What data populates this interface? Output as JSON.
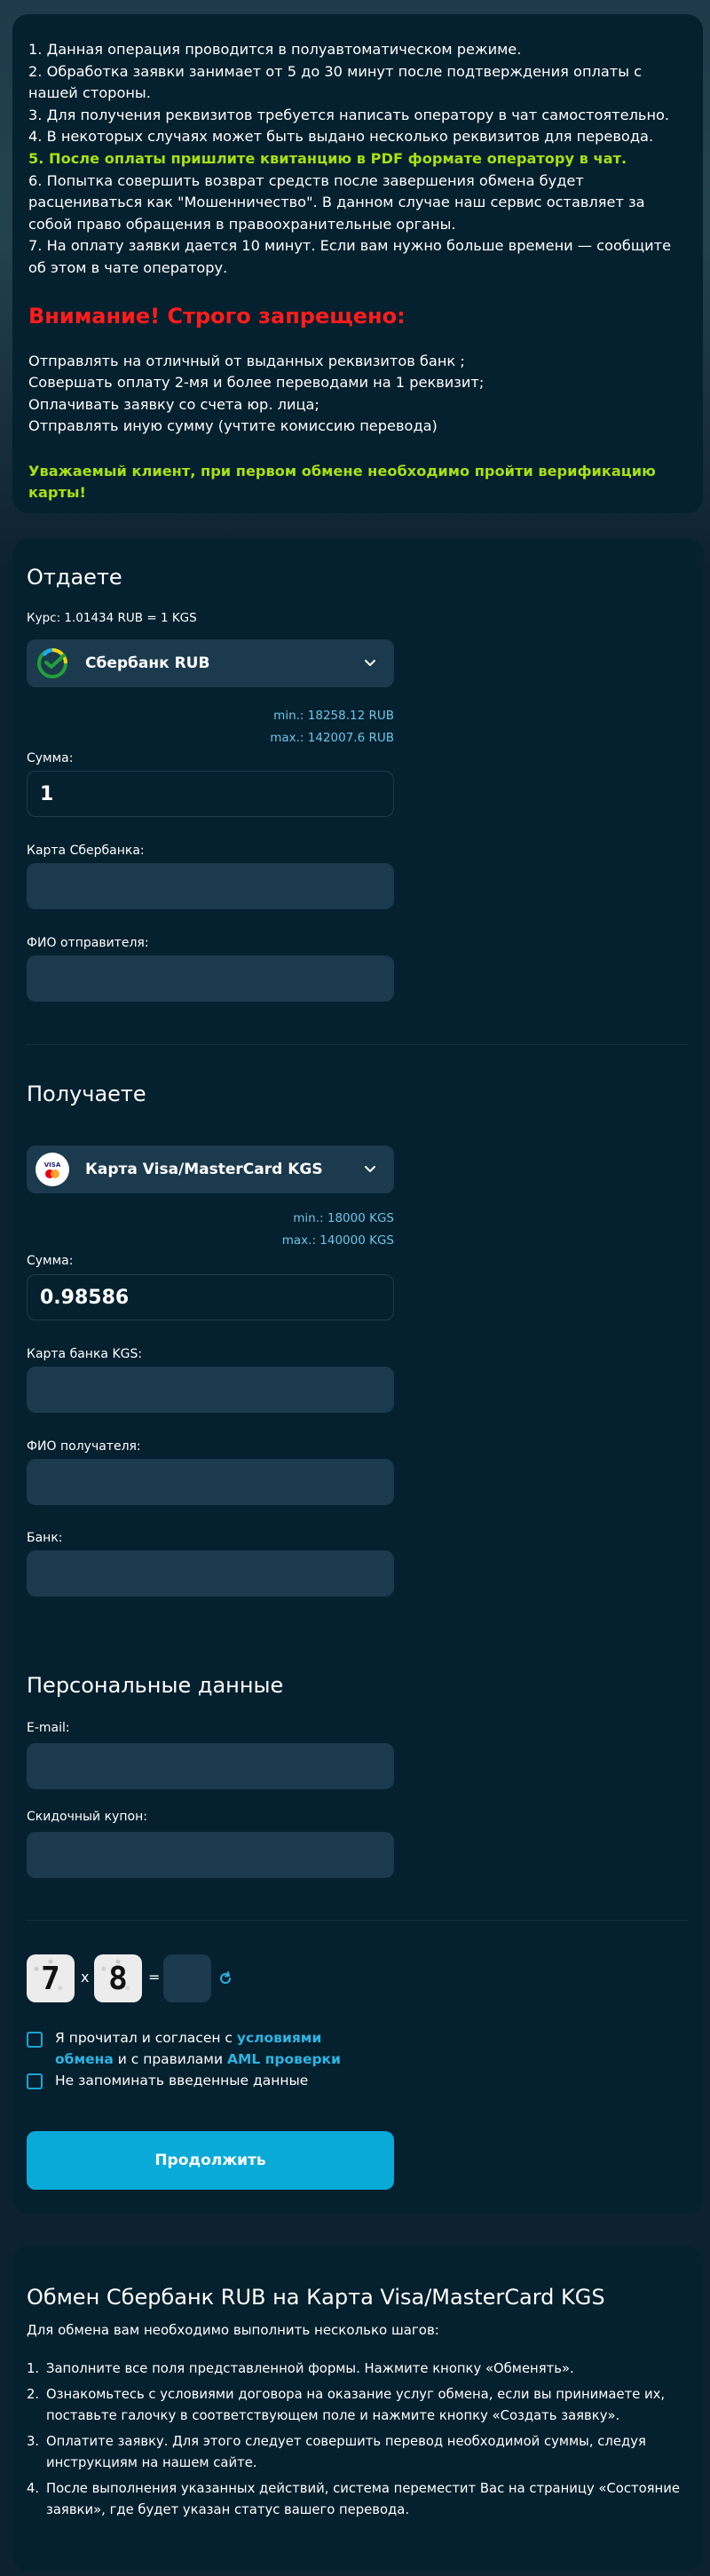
{
  "notice": {
    "rules": [
      "1. Данная операция проводится в полуавтоматическом режиме.",
      "2. Обработка заявки занимает от 5 до 30 минут после подтверждения оплаты с нашей стороны.",
      "3. Для получения реквизитов требуется написать оператору в чат самостоятельно.",
      "4. В некоторых случаях может быть выдано несколько реквизитов для перевода.",
      "5. После оплаты пришлите квитанцию в PDF формате оператору в чат.",
      "6. Попытка совершить возврат средств после завершения обмена будет расцениваться как \"Мошенничество\". В данном случае наш сервис оставляет за собой право обращения в правоохранительные органы.",
      "7. На оплату заявки дается 10 минут. Если вам нужно больше времени — сообщите об этом в чате оператору."
    ],
    "warning_title": "Внимание! Строго запрещено:",
    "forbidden": [
      "Отправлять на отличный от выданных реквизитов банк ;",
      "Совершать оплату 2-мя и более переводами на 1 реквизит;",
      "Оплачивать заявку со счета юр. лица;",
      "Отправлять иную сумму (учтите комиссию перевода)"
    ],
    "verification": "Уважаемый клиент, при первом обмене необходимо пройти верификацию карты!",
    "accent_green": "#a8e014",
    "accent_red": "#ff1c1c"
  },
  "give": {
    "title": "Отдаете",
    "rate": "Курс: 1.01434 RUB = 1 KGS",
    "currency": "Сбербанк RUB",
    "currency_icon": "sberbank-logo-icon",
    "min": "min.: 18258.12 RUB",
    "max": "max.: 142007.6 RUB",
    "amount_label": "Сумма:",
    "amount_value": "1",
    "card_label": "Карта Сбербанка:",
    "name_label": "ФИО отправителя:"
  },
  "get": {
    "title": "Получаете",
    "currency": "Карта Visa/MasterCard KGS",
    "currency_icon": "visa-mastercard-logo-icon",
    "min": "min.: 18000 KGS",
    "max": "max.: 140000 KGS",
    "amount_label": "Сумма:",
    "amount_value": "0.98586",
    "card_label": "Карта банка KGS:",
    "name_label": "ФИО получателя:",
    "bank_label": "Банк:"
  },
  "personal": {
    "title": "Персональные данные",
    "email_label": "E-mail:",
    "coupon_label": "Скидочный купон:"
  },
  "captcha": {
    "a": "7",
    "op": "x",
    "b": "8",
    "eq": "="
  },
  "agreement": {
    "prefix": "Я прочитал и согласен с ",
    "terms_link_1": "условиями",
    "terms_link_2": "обмена",
    "middle": " и с правилами ",
    "aml_link": "AML проверки",
    "remember": "Не запоминать введенные данные"
  },
  "submit_label": "Продолжить",
  "info": {
    "title": "Обмен Сбербанк RUB на Карта Visa/MasterCard KGS",
    "intro": "Для обмена вам необходимо выполнить несколько шагов:",
    "steps": [
      "Заполните все поля представленной формы. Нажмите кнопку «Обменять».",
      "Ознакомьтесь с условиями договора на оказание услуг обмена, если вы принимаете их, поставьте галочку в соответствующем поле и нажмите кнопку «Создать заявку».",
      "Оплатите заявку. Для этого следует совершить перевод необходимой суммы, следуя инструкциям на нашем сайте.",
      "После выполнения указанных действий, система переместит Вас на страницу «Состояние заявки», где будет указан статус вашего перевода."
    ],
    "step_numbers": [
      "1.",
      "2.",
      "3.",
      "4."
    ]
  },
  "colors": {
    "panel_bg": "#05202e",
    "field_bg": "#1b3a4e",
    "link": "#2cb4e3",
    "button": "#09aad8"
  }
}
